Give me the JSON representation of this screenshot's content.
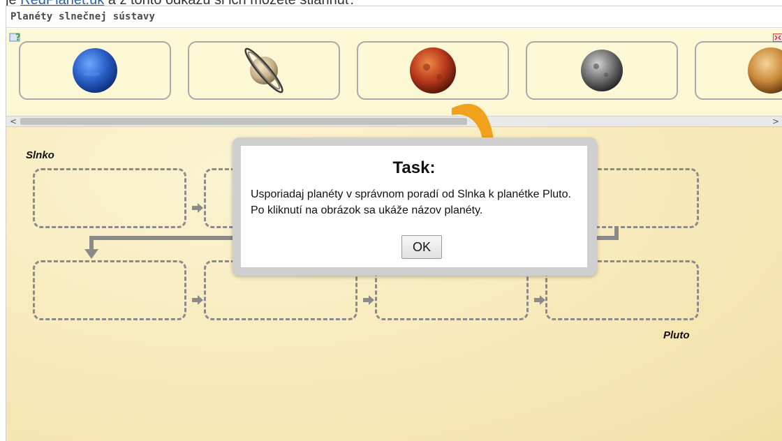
{
  "header_fragment": {
    "prefix": "je ",
    "link": "RedPlanet.uk",
    "suffix": " a z tohto odkazu si ich môžete stiahnuť."
  },
  "window": {
    "title": "Planéty slnečnej sústavy"
  },
  "toolbar": {
    "help_icon": "help-question-icon",
    "close_icon": "fullscreen-close-icon"
  },
  "tray": {
    "tiles": [
      {
        "planet_icon": "neptune-icon",
        "color": "#2a5fc7"
      },
      {
        "planet_icon": "saturn-icon",
        "color": "#c9b48a"
      },
      {
        "planet_icon": "mars-icon",
        "color": "#b8391b"
      },
      {
        "planet_icon": "mercury-icon",
        "color": "#6f6f6f"
      },
      {
        "planet_icon": "venus-icon",
        "color": "#c98a3a"
      }
    ]
  },
  "scrollbar": {
    "left_arrow": "<",
    "right_arrow": ">"
  },
  "board": {
    "start_label": "Slnko",
    "end_label": "Pluto"
  },
  "dialog": {
    "title": "Task:",
    "message": "Usporiadaj planéty v správnom poradí od Slnka k planétke Pluto. Po kliknutí na obrázok sa ukáže názov planéty.",
    "ok_label": "OK"
  },
  "colors": {
    "board_background": "#f8ebbe",
    "tray_background": "#fcf8d6",
    "slot_border": "#8a8a8a",
    "arrow_orange": "#f2a11c"
  }
}
